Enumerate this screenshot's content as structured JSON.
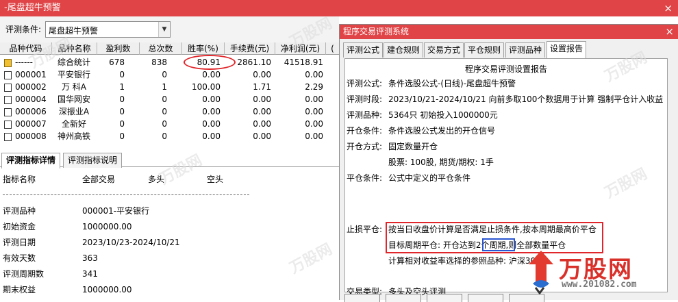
{
  "window": {
    "title": "-尾盘超牛预警",
    "close_glyph": "×"
  },
  "condition": {
    "label": "评测条件:",
    "value": "尾盘超牛预警",
    "dropdown_glyph": "▼"
  },
  "grid": {
    "headers": [
      "品种代码",
      "品种名称",
      "盈利数",
      "总次数",
      "胜率(%)",
      "手续费(元)",
      "净利润(元)",
      "("
    ],
    "rows": [
      {
        "code": "------",
        "name": "综合统计",
        "profit": "678",
        "total": "838",
        "winrate": "80.91",
        "fee": "2861.10",
        "net": "41518.91"
      },
      {
        "code": "000001",
        "name": "平安银行",
        "profit": "0",
        "total": "0",
        "winrate": "0.00",
        "fee": "0.00",
        "net": "0.00"
      },
      {
        "code": "000002",
        "name": "万 科A",
        "profit": "1",
        "total": "1",
        "winrate": "100.00",
        "fee": "1.71",
        "net": "2.29"
      },
      {
        "code": "000004",
        "name": "国华网安",
        "profit": "0",
        "total": "0",
        "winrate": "0.00",
        "fee": "0.00",
        "net": "0.00"
      },
      {
        "code": "000006",
        "name": "深振业A",
        "profit": "0",
        "total": "0",
        "winrate": "0.00",
        "fee": "0.00",
        "net": "0.00"
      },
      {
        "code": "000007",
        "name": "全新好",
        "profit": "0",
        "total": "0",
        "winrate": "0.00",
        "fee": "0.00",
        "net": "0.00"
      },
      {
        "code": "000008",
        "name": "神州高铁",
        "profit": "0",
        "total": "0",
        "winrate": "0.00",
        "fee": "0.00",
        "net": "0.00"
      }
    ]
  },
  "lower_tabs": [
    "评测指标详情",
    "评测指标说明"
  ],
  "detail": {
    "header": {
      "name": "指标名称",
      "all": "全部交易",
      "long": "多头",
      "short": "空头"
    },
    "rows": [
      {
        "label": "评测品种",
        "value": "000001-平安银行"
      },
      {
        "label": "初始资金",
        "value": "1000000.00"
      },
      {
        "label": "评测日期",
        "value": "2023/10/23-2024/10/21"
      },
      {
        "label": "有效天数",
        "value": "363"
      },
      {
        "label": "评测周期数",
        "value": " 341"
      },
      {
        "label": "期末权益",
        "value": "1000000.00"
      }
    ]
  },
  "dialog": {
    "title": "程序交易评测系统",
    "close_glyph": "×",
    "tabs": [
      "评测公式",
      "建仓规则",
      "交易方式",
      "平仓规则",
      "评测品种",
      "设置报告"
    ],
    "report_title": "程序交易评测设置报告",
    "report": [
      {
        "label": "评测公式:",
        "value": "条件选股公式-(日线)-尾盘超牛预警"
      },
      {
        "label": "评测时段:",
        "value": "2023/10/21-2024/10/21 向前多取100个数据用于计算 强制平仓计入收益"
      },
      {
        "label": "评测品种:",
        "value": "5364只 初始投入1000000元"
      },
      {
        "label": "开仓条件:",
        "value": "条件选股公式发出的开仓信号"
      },
      {
        "label": "开仓方式:",
        "value": "固定数量开仓"
      },
      {
        "label": "",
        "value": "股票: 100股, 期货/期权: 1手"
      },
      {
        "label": "平仓条件:",
        "value": "公式中定义的平仓条件"
      },
      {
        "label": "止损平仓:",
        "value": "按当日收盘价计算是否满足止损条件,按本周期最高价平仓"
      },
      {
        "label": "",
        "value": "目标周期平仓: 开仓达到2个周期,则全部数量平仓"
      },
      {
        "label": "",
        "value": "计算相对收益率选择的参照品种: 沪深300"
      },
      {
        "label": "交易类型:",
        "value": "多头及空头评测"
      }
    ]
  },
  "watermark": {
    "brand": "万股网",
    "url": "www.201082.com",
    "tile_text": "万股网"
  },
  "colors": {
    "titlebar": "#e04446",
    "highlight_red": "#e0262a",
    "highlight_blue": "#2a55d0"
  }
}
